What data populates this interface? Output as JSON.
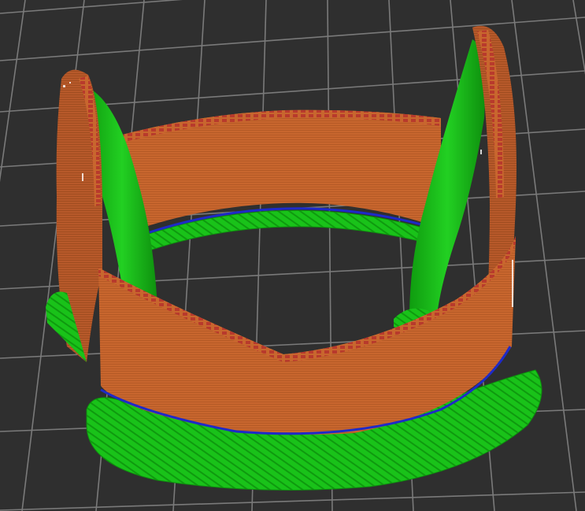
{
  "app": {
    "view": "3d-slice-preview",
    "bed_color": "#2f2f2f",
    "grid_color": "#7a7a7a"
  },
  "model": {
    "kind": "curved-band-part",
    "perimeter_color": "#c8662e",
    "perimeter_dark": "#a8501f",
    "infill_color": "#b83a2c",
    "support_color": "#19c219",
    "support_dark": "#0e8e0e",
    "bridge_color": "#1e2ac8"
  }
}
